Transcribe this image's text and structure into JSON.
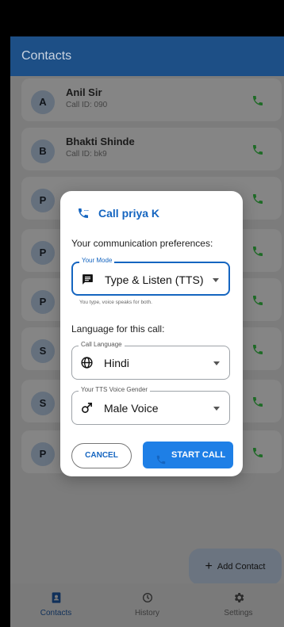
{
  "app_bar": {
    "title": "Contacts"
  },
  "contacts": [
    {
      "initial": "A",
      "name": "Anil Sir",
      "sub": "Call ID: 090"
    },
    {
      "initial": "B",
      "name": "Bhakti Shinde",
      "sub": "Call ID: bk9"
    },
    {
      "initial": "P",
      "name": "",
      "sub": ""
    },
    {
      "initial": "P",
      "name": "",
      "sub": ""
    },
    {
      "initial": "P",
      "name": "",
      "sub": ""
    },
    {
      "initial": "S",
      "name": "",
      "sub": ""
    },
    {
      "initial": "S",
      "name": "",
      "sub": ""
    },
    {
      "initial": "P",
      "name": "",
      "sub": ""
    }
  ],
  "fab": {
    "label": "Add Contact",
    "plus": "+"
  },
  "bottom_nav": [
    {
      "label": "Contacts",
      "icon": "contacts-icon",
      "active": true
    },
    {
      "label": "History",
      "icon": "history-icon",
      "active": false
    },
    {
      "label": "Settings",
      "icon": "gear-icon",
      "active": false
    }
  ],
  "dialog": {
    "title": "Call priya K",
    "prefs_label": "Your communication preferences:",
    "mode": {
      "legend": "Your Mode",
      "value": "Type & Listen (TTS)",
      "icon": "message-icon",
      "helper": "You type, voice speaks for both."
    },
    "language_label": "Language for this call:",
    "language": {
      "legend": "Call Language",
      "value": "Hindi",
      "icon": "globe-icon"
    },
    "voice": {
      "legend": "Your TTS Voice Gender",
      "value": "Male Voice",
      "icon": "male-icon"
    },
    "cancel_label": "CANCEL",
    "start_label": "START CALL"
  },
  "colors": {
    "primary": "#1565c0",
    "button": "#1e7fe6",
    "call_green": "#1e6b26",
    "app_bar": "#1d4f86"
  }
}
